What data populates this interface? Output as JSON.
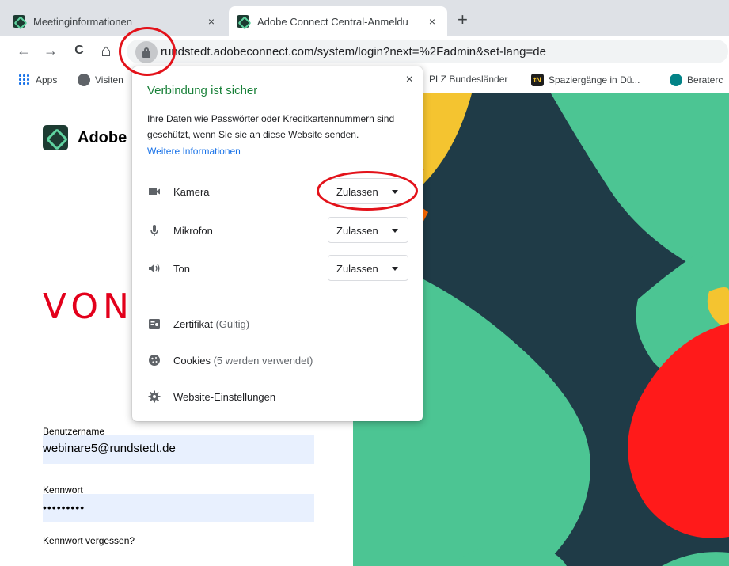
{
  "tabs": [
    {
      "title": "Meetinginformationen",
      "close": "×"
    },
    {
      "title": "Adobe Connect Central-Anmeldu",
      "close": "×"
    }
  ],
  "new_tab_glyph": "+",
  "toolbar": {
    "back_glyph": "←",
    "forward_glyph": "→",
    "reload_glyph": "C",
    "home_glyph": "⌂",
    "url": "rundstedt.adobeconnect.com/system/login?next=%2Fadmin&set-lang=de"
  },
  "bookmarks": [
    {
      "label": "Apps",
      "icon": "apps-grid-icon"
    },
    {
      "label": "Visiten",
      "icon": "globe-icon"
    },
    {
      "label": "PLZ Bundesländer",
      "icon": "none"
    },
    {
      "label": "Spaziergänge in Dü...",
      "icon": "tn-icon"
    },
    {
      "label": "Beraterc",
      "icon": "sharepoint-icon"
    }
  ],
  "page": {
    "brand": "Adobe",
    "company_fragment": "VON R",
    "username_label": "Benutzername",
    "username_value": "webinare5@rundstedt.de",
    "password_label": "Kennwort",
    "password_value": "•••••••••",
    "forgot_link": "Kennwort vergessen?"
  },
  "popup": {
    "close": "×",
    "title": "Verbindung ist sicher",
    "description": "Ihre Daten wie Passwörter oder Kreditkartennummern sind geschützt, wenn Sie sie an diese Website senden.",
    "more_info": "Weitere Informationen",
    "permissions": [
      {
        "label": "Kamera",
        "value": "Zulassen",
        "icon": "camera-icon"
      },
      {
        "label": "Mikrofon",
        "value": "Zulassen",
        "icon": "microphone-icon"
      },
      {
        "label": "Ton",
        "value": "Zulassen",
        "icon": "speaker-icon"
      }
    ],
    "rows": [
      {
        "label": "Zertifikat",
        "note": "(Gültig)",
        "icon": "certificate-icon"
      },
      {
        "label": "Cookies",
        "note": "(5 werden verwendet)",
        "icon": "cookie-icon"
      },
      {
        "label": "Website-Einstellungen",
        "note": "",
        "icon": "gear-icon"
      }
    ]
  },
  "colors": {
    "secure_green": "#188038",
    "link_blue": "#1a73e8",
    "annotation_red": "#e3121a",
    "brand_red": "#e3001b",
    "art_dark": "#1f3b47",
    "art_green": "#4cc593",
    "art_orange": "#ff6a00",
    "art_yellow": "#f4c430",
    "art_red": "#ff1a1a"
  }
}
